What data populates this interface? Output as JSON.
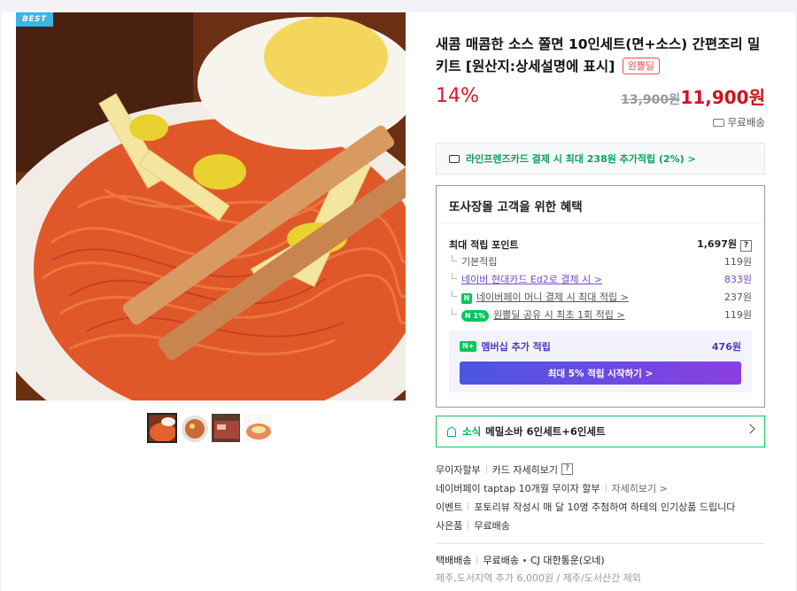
{
  "product": {
    "badge": "BEST",
    "title": "새콤 매콤한 소스 쫄면 10인세트(면+소스) 간편조리 밀키트 [원산지:상세설명에 표시]",
    "tag": "원쁠딜",
    "discount": "14%",
    "original_price": "13,900원",
    "sale_price": "11,900원",
    "shipping": "무료배송"
  },
  "card_promo": "라인프렌즈카드 결제 시 최대 238원 추가적립 (2%) >",
  "benefit": {
    "title": "또사장몰 고객을 위한 혜택",
    "max_label": "최대 적립 포인트",
    "max_value": "1,697원",
    "help": "?",
    "rows": [
      {
        "label": "기본적립",
        "value": "119원"
      },
      {
        "label": "네이버 현대카드 Ed2로 결제 시 >",
        "value": "833원"
      },
      {
        "label": "네이버페이 머니 결제 시 최대 적립 >",
        "value": "237원",
        "badge": "N"
      },
      {
        "label": "원쁠딜 공유 시 최초 1회 적립 >",
        "value": "119원",
        "badge": "N 1%"
      }
    ],
    "member_badge": "N+",
    "member_label": "멤버십 추가 적립",
    "member_value": "476원",
    "member_button": "최대 5% 적립 시작하기 >"
  },
  "news": {
    "label": "소식",
    "text": "메밀소바 6인세트+6인세트"
  },
  "info": {
    "installment": "무이자할부",
    "card_detail": "카드 자세히보기",
    "help": "?",
    "npay": "네이버페이 taptap 10개월 무이자 할부",
    "npay_detail": "자세히보기 >",
    "event_label": "이벤트",
    "event_text": "포토리뷰 작성시 매 달 10명 추첨하여 하테의 인기상품 드립니다",
    "gift_label": "사은품",
    "gift_text": "무료배송"
  },
  "delivery": {
    "label": "택배배송",
    "fee": "무료배송",
    "carrier": "CJ 대한통운(오네)",
    "note": "제주,도서지역 추가 6,000원 / 제주/도서산간 제외"
  }
}
